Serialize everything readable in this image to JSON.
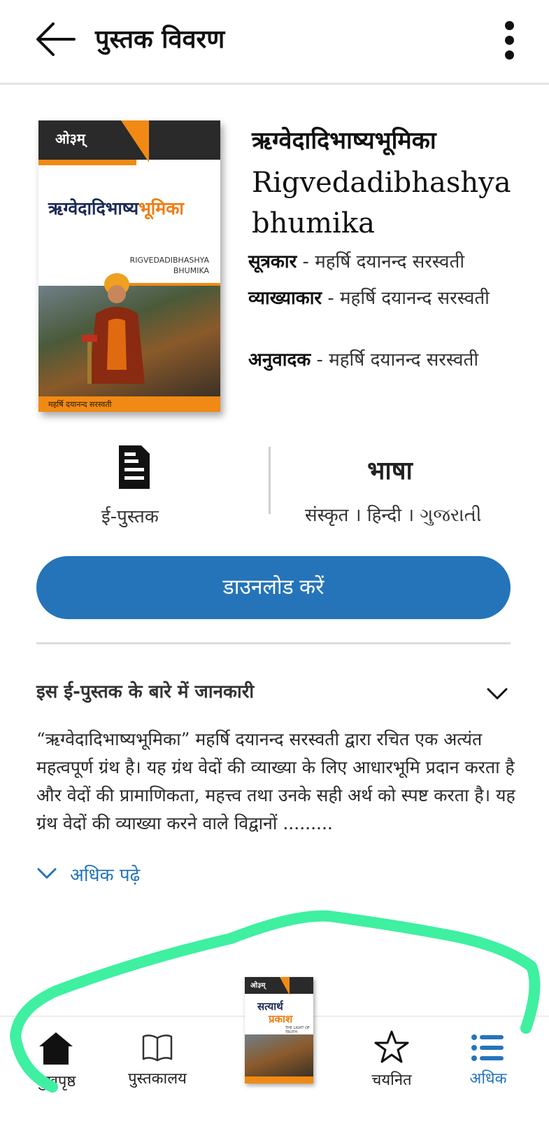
{
  "header": {
    "title": "पुस्तक विवरण"
  },
  "cover": {
    "om": "ओ३म्",
    "title_main": "ऋग्वेदादिभाष्य",
    "title_highlight": "भूमिका",
    "subtitle_line1": "RIGVEDADIBHASHYA",
    "subtitle_line2": "BHUMIKA",
    "footer": "महर्षि दयानन्द सरस्वती"
  },
  "book": {
    "title_hindi": "ऋग्वेदादिभाष्यभूमिका",
    "title_english": "Rigvedadibhashya bhumika",
    "credits": [
      {
        "role": "सूत्रकार",
        "sep": " - ",
        "name": "महर्षि दयानन्द सरस्वती"
      },
      {
        "role": "व्याख्याकार",
        "sep": " - ",
        "name": "महर्षि दयानन्द सरस्वती"
      },
      {
        "role": "अनुवादक",
        "sep": " - ",
        "name": "महर्षि दयानन्द सरस्वती"
      }
    ]
  },
  "format": {
    "label": "ई-पुस्तक",
    "icon": "ebook-icon"
  },
  "language": {
    "title": "भाषा",
    "values": "संस्कृत । हिन्दी । ગુજરાતી"
  },
  "download": {
    "label": "डाउनलोड करें"
  },
  "about": {
    "title": "इस ई-पुस्तक के बारे में जानकारी",
    "text": "“ऋग्वेदादिभाष्यभूमिका” महर्षि दयानन्द सरस्वती द्वारा रचित एक अत्यंत महत्वपूर्ण ग्रंथ है। यह ग्रंथ वेदों की व्याख्या के लिए आधारभूमि प्रदान करता है और वेदों की प्रामाणिकता, महत्त्व तथा उनके सही अर्थ को स्पष्ट करता है। यह ग्रंथ वेदों की व्याख्या करने वाले विद्वानों .........",
    "read_more": "अधिक पढ़े"
  },
  "bottom_nav": {
    "items": [
      {
        "label": "मुखपृष्ठ",
        "icon": "home-icon"
      },
      {
        "label": "पुस्तकालय",
        "icon": "book-open-icon"
      },
      {
        "label": "चयनित",
        "icon": "star-icon"
      },
      {
        "label": "अधिक",
        "icon": "list-icon",
        "active": true
      }
    ],
    "center_book": {
      "om": "ओ३म्",
      "title1": "सत्यार्थ",
      "title2": "प्रकाश",
      "subtitle": "THE LIGHT OF TRUTH"
    }
  },
  "colors": {
    "accent": "#2574b9",
    "cover_orange": "#f08a14",
    "annotation": "#3ef0a0"
  }
}
